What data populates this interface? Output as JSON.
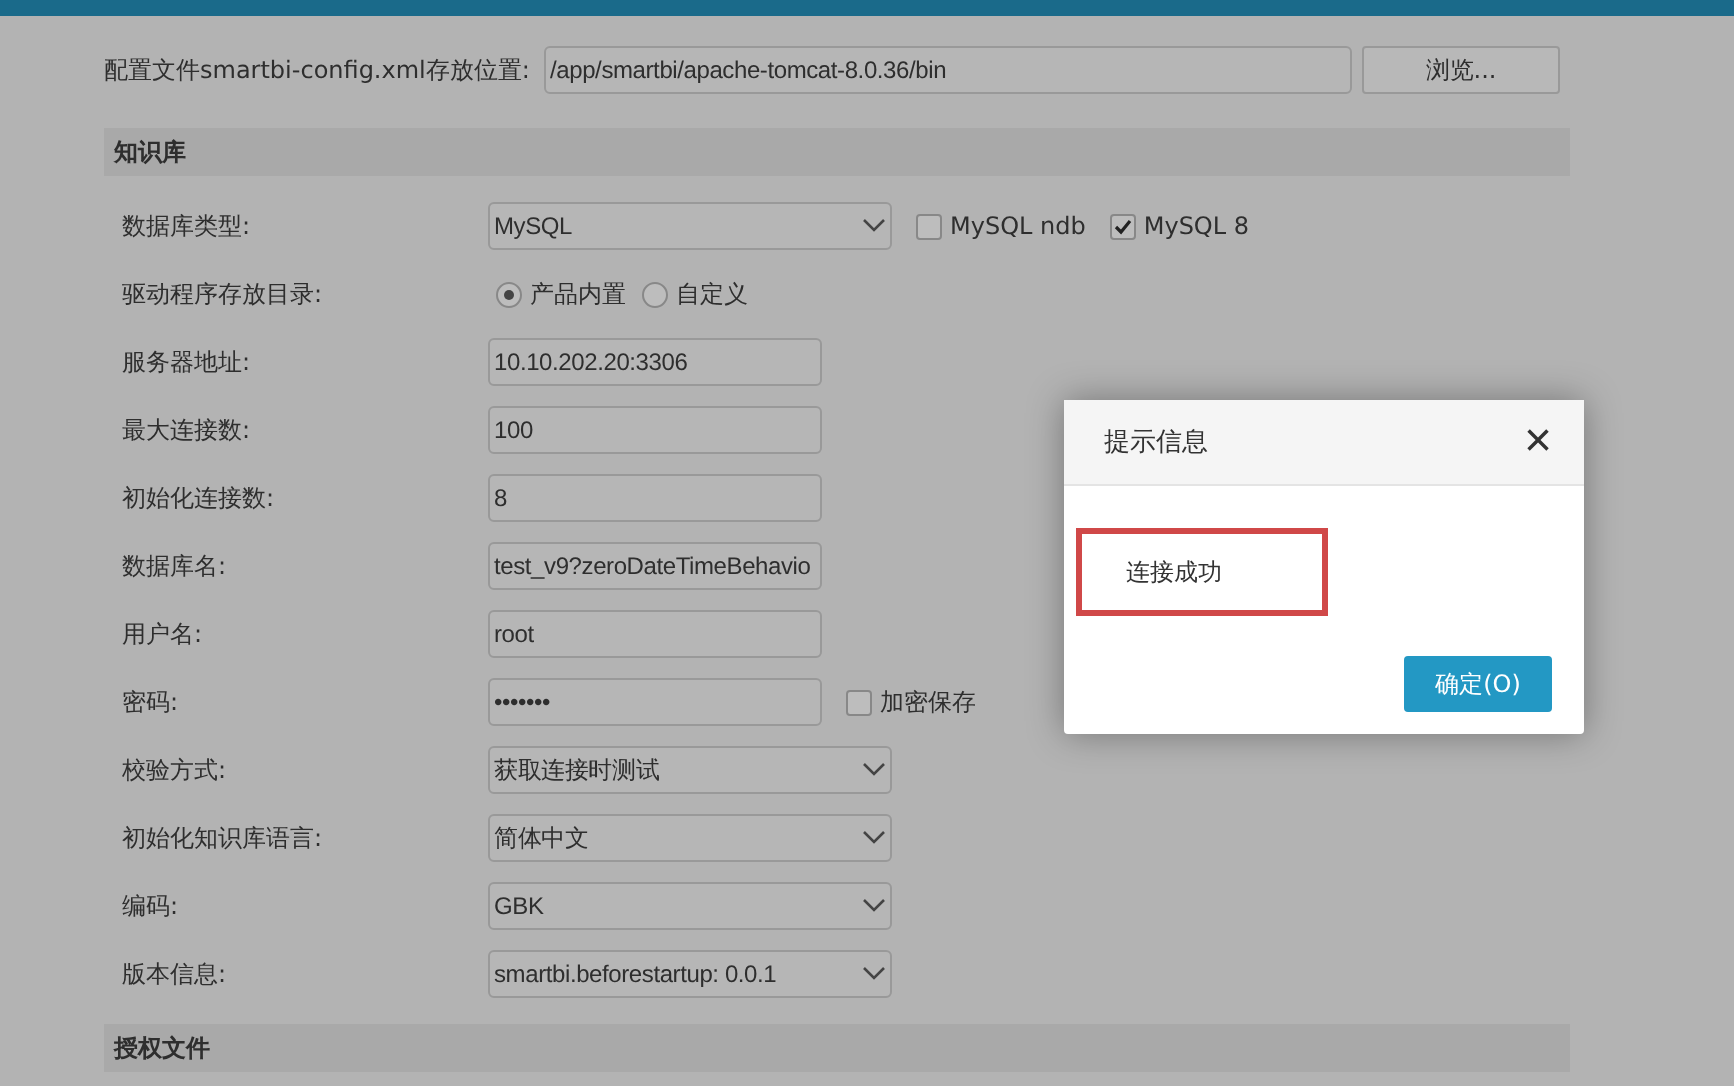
{
  "config": {
    "label": "配置文件smartbi-config.xml存放位置:",
    "value": "/app/smartbi/apache-tomcat-8.0.36/bin",
    "browse": "浏览..."
  },
  "sections": [
    {
      "title": "知识库",
      "rows": [
        {
          "kind": "select",
          "label": "数据库类型:",
          "value": "MySQL",
          "checkboxes": [
            {
              "label": "MySQL ndb",
              "checked": false
            },
            {
              "label": "MySQL 8",
              "checked": true
            }
          ]
        },
        {
          "kind": "radio",
          "label": "驱动程序存放目录:",
          "options": [
            {
              "label": "产品内置",
              "selected": true
            },
            {
              "label": "自定义",
              "selected": false
            }
          ]
        },
        {
          "kind": "input",
          "label": "服务器地址:",
          "value": "10.10.202.20:3306"
        },
        {
          "kind": "input",
          "label": "最大连接数:",
          "value": "100"
        },
        {
          "kind": "input",
          "label": "初始化连接数:",
          "value": "8"
        },
        {
          "kind": "input",
          "label": "数据库名:",
          "value": "test_v9?zeroDateTimeBehavio"
        },
        {
          "kind": "input",
          "label": "用户名:",
          "value": "root"
        },
        {
          "kind": "input",
          "label": "密码:",
          "value": "•••••••",
          "checkboxes": [
            {
              "label": "加密保存",
              "checked": false
            }
          ]
        },
        {
          "kind": "select",
          "label": "校验方式:",
          "value": "获取连接时测试"
        },
        {
          "kind": "select",
          "label": "初始化知识库语言:",
          "value": "简体中文"
        },
        {
          "kind": "select",
          "label": "编码:",
          "value": "GBK"
        },
        {
          "kind": "select",
          "label": "版本信息:",
          "value": "smartbi.beforestartup: 0.0.1"
        }
      ]
    },
    {
      "title": "授权文件"
    }
  ],
  "dialog": {
    "title": "提示信息",
    "close": "×",
    "message": "连接成功",
    "button": "确定(O)"
  }
}
